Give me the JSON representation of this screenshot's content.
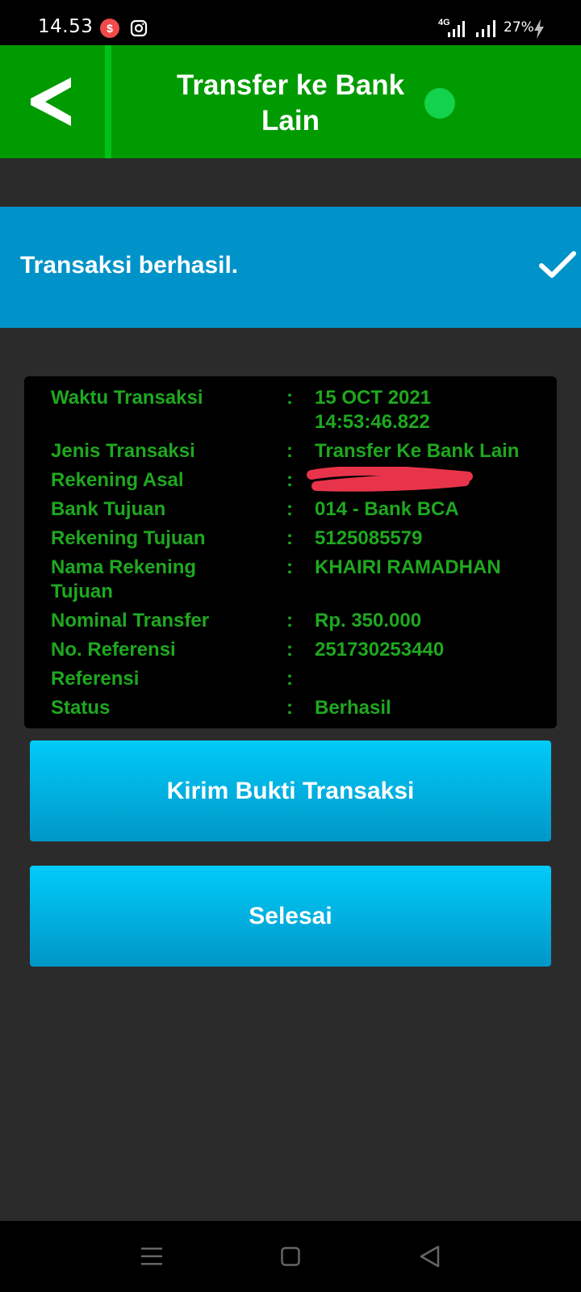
{
  "status_bar": {
    "time": "14.53",
    "network": "4G",
    "battery": "27%",
    "icons": [
      "s-notification-icon",
      "instagram-icon",
      "signal-4g-icon",
      "signal-icon",
      "charging-bolt-icon"
    ]
  },
  "header": {
    "title": "Transfer ke Bank Lain",
    "back_icon": "chevron-left-icon"
  },
  "banner": {
    "text": "Transaksi berhasil.",
    "icon": "check-icon"
  },
  "details": {
    "colon": ":",
    "rows": [
      {
        "label": "Waktu Transaksi",
        "value": "15 OCT 2021 14:53:46.822"
      },
      {
        "label": "Jenis Transaksi",
        "value": "Transfer Ke Bank Lain"
      },
      {
        "label": "Rekening Asal",
        "value": ""
      },
      {
        "label": "Bank Tujuan",
        "value": "014 - Bank BCA"
      },
      {
        "label": "Rekening Tujuan",
        "value": "5125085579"
      },
      {
        "label": "Nama Rekening Tujuan",
        "value": "KHAIRI RAMADHAN"
      },
      {
        "label": "Nominal Transfer",
        "value": "Rp. 350.000"
      },
      {
        "label": "No. Referensi",
        "value": "251730253440"
      },
      {
        "label": "Referensi",
        "value": ""
      },
      {
        "label": "Status",
        "value": "Berhasil"
      }
    ]
  },
  "buttons": {
    "send_proof": "Kirim Bukti Transaksi",
    "done": "Selesai"
  },
  "colors": {
    "header": "#009b00",
    "banner": "#0093c9",
    "detail_text": "#1fa81f",
    "button": "#00b6e6",
    "background": "#2b2b2b"
  }
}
